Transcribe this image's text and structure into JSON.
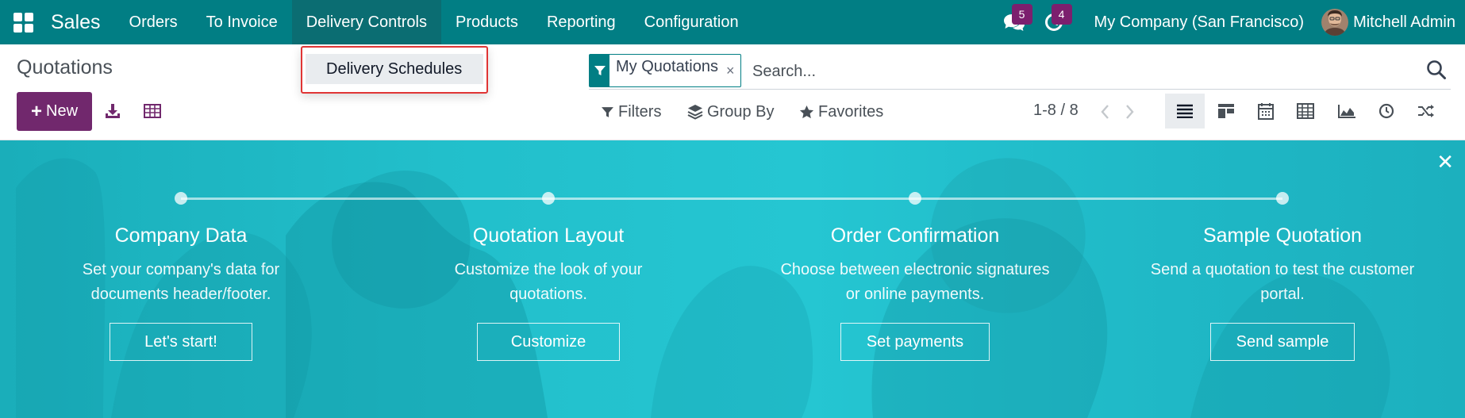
{
  "navbar": {
    "app_name": "Sales",
    "menu": [
      {
        "label": "Orders"
      },
      {
        "label": "To Invoice"
      },
      {
        "label": "Delivery Controls"
      },
      {
        "label": "Products"
      },
      {
        "label": "Reporting"
      },
      {
        "label": "Configuration"
      }
    ],
    "active_menu": "Delivery Controls",
    "messages_count": "5",
    "activities_count": "4",
    "company": "My Company (San Francisco)",
    "user": "Mitchell Admin"
  },
  "dropdown": {
    "items": [
      {
        "label": "Delivery Schedules"
      }
    ]
  },
  "control_panel": {
    "breadcrumb": "Quotations",
    "new_label": "New",
    "search": {
      "facet_label": "My Quotations",
      "placeholder": "Search..."
    },
    "filters_label": "Filters",
    "group_by_label": "Group By",
    "favorites_label": "Favorites",
    "pager": "1-8 / 8",
    "views": [
      "list-icon",
      "kanban-icon",
      "calendar-icon",
      "pivot-icon",
      "graph-icon",
      "activity-icon",
      "cohort-icon"
    ],
    "active_view": "list-icon"
  },
  "onboarding": {
    "steps": [
      {
        "title": "Company Data",
        "desc_line1": "Set your company's data for",
        "desc_line2": "documents header/footer.",
        "button": "Let's start!"
      },
      {
        "title": "Quotation Layout",
        "desc_line1": "Customize the look of your",
        "desc_line2": "quotations.",
        "button": "Customize"
      },
      {
        "title": "Order Confirmation",
        "desc_line1": "Choose between electronic signatures",
        "desc_line2": "or online payments.",
        "button": "Set payments"
      },
      {
        "title": "Sample Quotation",
        "desc_line1": "Send a quotation to test the customer",
        "desc_line2": "portal.",
        "button": "Send sample"
      }
    ]
  },
  "colors": {
    "navbar": "#017e84",
    "primary_button": "#71286d",
    "badge": "#7c1f6e",
    "banner": "#22bfcb",
    "highlight_border": "#e03535"
  }
}
